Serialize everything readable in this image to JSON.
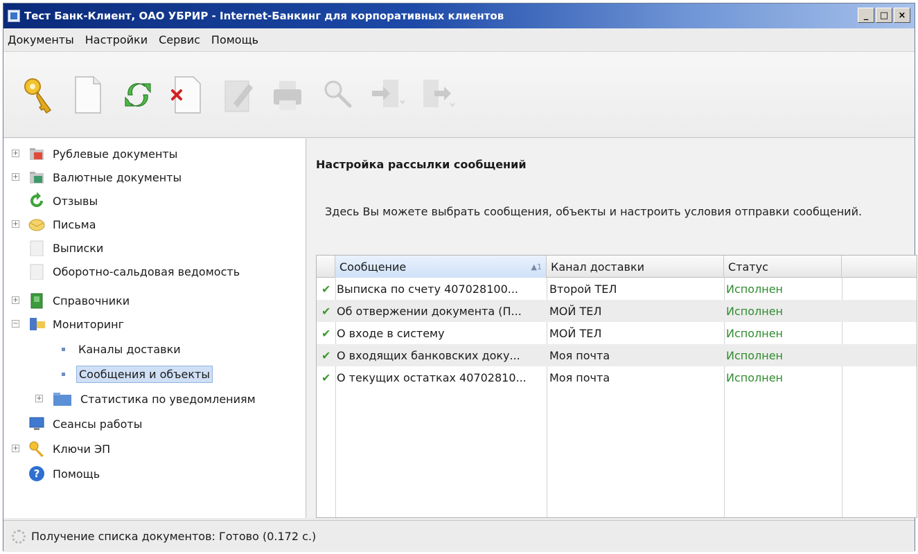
{
  "window": {
    "title": "Тест Банк-Клиент, ОАО УБРИР - Internet-Банкинг для корпоративных клиентов",
    "buttons": [
      "_",
      "□",
      "×"
    ]
  },
  "menu": [
    "Документы",
    "Настройки",
    "Сервис",
    "Помощь"
  ],
  "toolbar": [
    {
      "icon": "key-icon",
      "enabled": true
    },
    {
      "icon": "new-document-icon",
      "enabled": true
    },
    {
      "icon": "refresh-icon",
      "enabled": true
    },
    {
      "icon": "delete-icon",
      "enabled": true
    },
    {
      "icon": "edit-icon",
      "enabled": false
    },
    {
      "icon": "print-icon",
      "enabled": false
    },
    {
      "icon": "search-icon",
      "enabled": false
    },
    {
      "icon": "import-icon",
      "enabled": false
    },
    {
      "icon": "export-icon",
      "enabled": false
    }
  ],
  "tree": [
    {
      "label": "Рублевые документы",
      "icon": "ruble-folder-icon",
      "expander": "+"
    },
    {
      "label": "Валютные документы",
      "icon": "currency-folder-icon",
      "expander": "+"
    },
    {
      "label": "Отзывы",
      "icon": "recall-icon",
      "expander": ""
    },
    {
      "label": "Письма",
      "icon": "letters-icon",
      "expander": "+"
    },
    {
      "label": "Выписки",
      "icon": "statement-icon",
      "expander": ""
    },
    {
      "label": "Оборотно-сальдовая ведомость",
      "icon": "balance-sheet-icon",
      "expander": ""
    },
    {
      "label": "Справочники",
      "icon": "reference-book-icon",
      "expander": "+"
    },
    {
      "label": "Мониторинг",
      "icon": "monitoring-icon",
      "expander": "−"
    },
    {
      "label": "Каналы доставки",
      "icon": "bullet",
      "expander": ""
    },
    {
      "label": "Сообщения и объекты",
      "icon": "bullet",
      "expander": "",
      "selected": true
    },
    {
      "label": "Статистика по уведомлениям",
      "icon": "folder-icon",
      "expander": "+"
    },
    {
      "label": "Сеансы работы",
      "icon": "monitor-icon",
      "expander": ""
    },
    {
      "label": "Ключи ЭП",
      "icon": "keys-icon",
      "expander": "+"
    },
    {
      "label": "Помощь",
      "icon": "help-icon",
      "expander": ""
    }
  ],
  "content": {
    "heading": "Настройка рассылки сообщений",
    "description": "Здесь Вы можете выбрать сообщения, объекты и настроить условия отправки сообщений."
  },
  "grid": {
    "columns": [
      "Сообщение",
      "Канал доставки",
      "Статус"
    ],
    "sort_indicator": "▲1",
    "rows": [
      {
        "message": "Выписка по счету 407028100...",
        "channel": "Второй ТЕЛ",
        "status": "Исполнен"
      },
      {
        "message": "Об отвержении документа (П...",
        "channel": "МОЙ ТЕЛ",
        "status": "Исполнен"
      },
      {
        "message": "О входе в систему",
        "channel": "МОЙ ТЕЛ",
        "status": "Исполнен"
      },
      {
        "message": "О входящих банковских доку...",
        "channel": "Моя почта",
        "status": "Исполнен"
      },
      {
        "message": "О текущих остатках 40702810...",
        "channel": "Моя почта",
        "status": "Исполнен"
      }
    ]
  },
  "statusbar": {
    "text": "Получение списка документов: Готово (0.172 с.)"
  },
  "colors": {
    "title_gradient_start": "#0a2a7a",
    "selection": "#cfe0f6",
    "status_ok": "#2e8c2e"
  }
}
